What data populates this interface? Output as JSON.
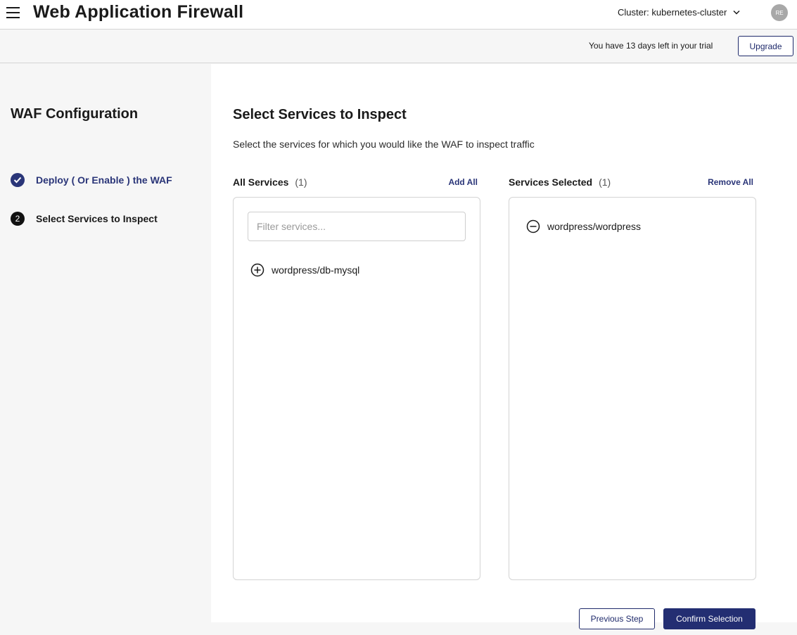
{
  "header": {
    "menu_icon": "hamburger-menu-icon",
    "title": "Web Application Firewall",
    "cluster_label": "Cluster: kubernetes-cluster",
    "cluster_icon": "chevron-down-icon",
    "avatar_initials": "RE"
  },
  "trial": {
    "text": "You have 13 days left in your trial",
    "upgrade_label": "Upgrade"
  },
  "sidebar": {
    "title": "WAF Configuration",
    "steps": [
      {
        "label": "Deploy ( Or Enable ) the WAF",
        "status": "completed",
        "icon": "check-circle-icon"
      },
      {
        "number": "2",
        "label": "Select Services to Inspect",
        "status": "current"
      }
    ]
  },
  "main": {
    "title": "Select Services to Inspect",
    "subtitle": "Select the services for which you would like the WAF to inspect traffic",
    "all_services": {
      "title": "All Services",
      "count": "(1)",
      "action": "Add All",
      "filter_placeholder": "Filter services...",
      "filter_value": "",
      "items": [
        {
          "name": "wordpress/db-mysql",
          "icon": "plus-circle-icon"
        }
      ]
    },
    "selected_services": {
      "title": "Services Selected",
      "count": "(1)",
      "action": "Remove All",
      "items": [
        {
          "name": "wordpress/wordpress",
          "icon": "minus-circle-icon"
        }
      ]
    }
  },
  "footer": {
    "previous_label": "Previous Step",
    "confirm_label": "Confirm Selection"
  },
  "colors": {
    "accent": "#232e72",
    "border": "#d4d4d4",
    "sidebar_bg": "#f6f6f6"
  }
}
